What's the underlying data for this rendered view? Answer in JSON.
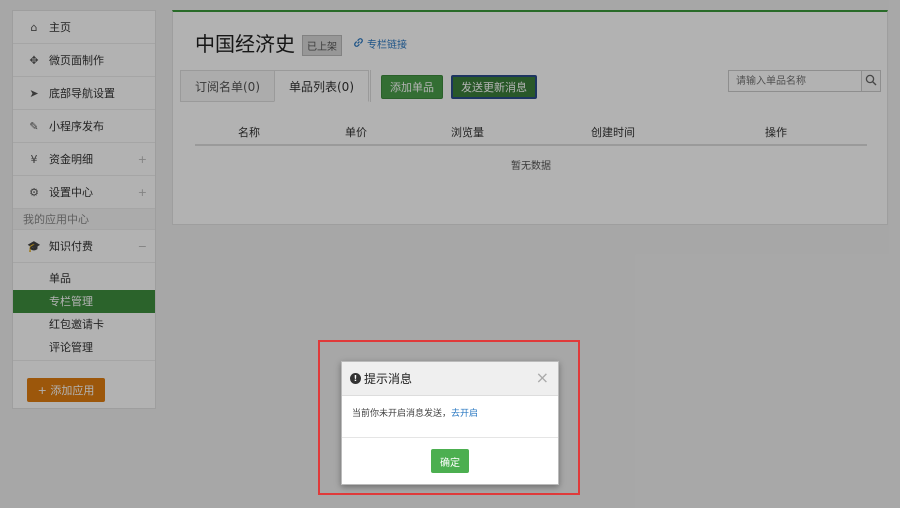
{
  "sidebar": {
    "items": [
      {
        "label": "主页",
        "icon": "home-icon",
        "glyph": "⌂"
      },
      {
        "label": "微页面制作",
        "icon": "move-icon",
        "glyph": "✥"
      },
      {
        "label": "底部导航设置",
        "icon": "navigation-icon",
        "glyph": "➤"
      },
      {
        "label": "小程序发布",
        "icon": "edit-icon",
        "glyph": "✎"
      },
      {
        "label": "资金明细",
        "icon": "money-bag-icon",
        "glyph": "¥",
        "expand": "+"
      },
      {
        "label": "设置中心",
        "icon": "gear-icon",
        "glyph": "⚙",
        "expand": "+"
      }
    ],
    "section_title": "我的应用中心",
    "group": {
      "label": "知识付费",
      "icon": "graduation-cap-icon",
      "glyph": "🎓",
      "collapse": "−"
    },
    "sub_items": [
      {
        "label": "单品",
        "active": false
      },
      {
        "label": "专栏管理",
        "active": true
      },
      {
        "label": "红包邀请卡",
        "active": false
      },
      {
        "label": "评论管理",
        "active": false
      }
    ],
    "add_app_label": "+ 添加应用"
  },
  "main": {
    "title": "中国经济史",
    "status_badge": "已上架",
    "column_link": "专栏链接",
    "tabs": [
      {
        "label": "订阅名单(0)",
        "active": false
      },
      {
        "label": "单品列表(0)",
        "active": true
      }
    ],
    "add_single_button": "添加单品",
    "send_update_button": "发送更新消息",
    "search": {
      "placeholder": "请输入单品名称"
    },
    "table": {
      "columns": [
        "名称",
        "单价",
        "浏览量",
        "创建时间",
        "操作"
      ],
      "empty_text": "暂无数据"
    }
  },
  "dialog": {
    "title": "提示消息",
    "message": "当前你未开启消息发送，",
    "link": "去开启",
    "ok_label": "确定",
    "close_glyph": "×"
  },
  "colors": {
    "accent_green": "#3e8e3e",
    "orange": "#e07d10",
    "highlight_red": "#e03a3a",
    "link_blue": "#2a78c2"
  }
}
